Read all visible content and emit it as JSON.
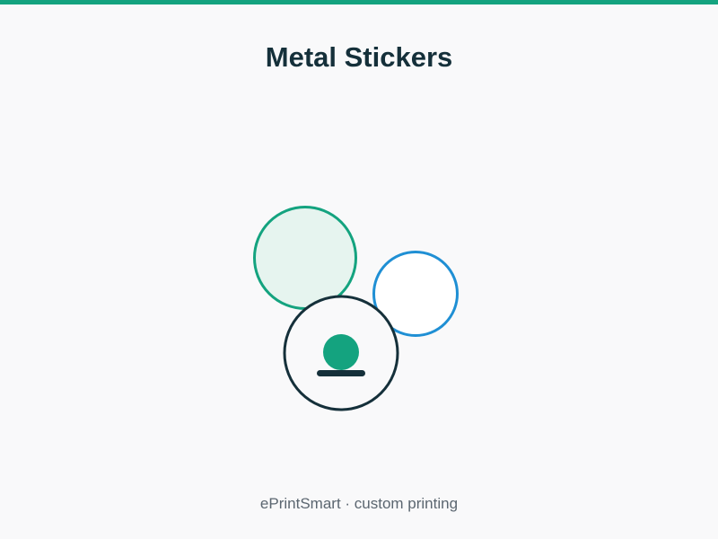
{
  "title": "Metal Stickers",
  "footer": "ePrintSmart · custom printing",
  "colors": {
    "accent": "#14a37f",
    "accent_light": "#e6f4ef",
    "blue": "#1f8fd4",
    "dark": "#15303a",
    "background": "#f9f9fa",
    "white": "#ffffff",
    "footer_text": "#5b6670"
  },
  "icons": {
    "large_circle": "green-sticker-circle-icon",
    "small_circle": "blue-sticker-circle-icon",
    "front_badge": "metal-sticker-badge-icon"
  }
}
